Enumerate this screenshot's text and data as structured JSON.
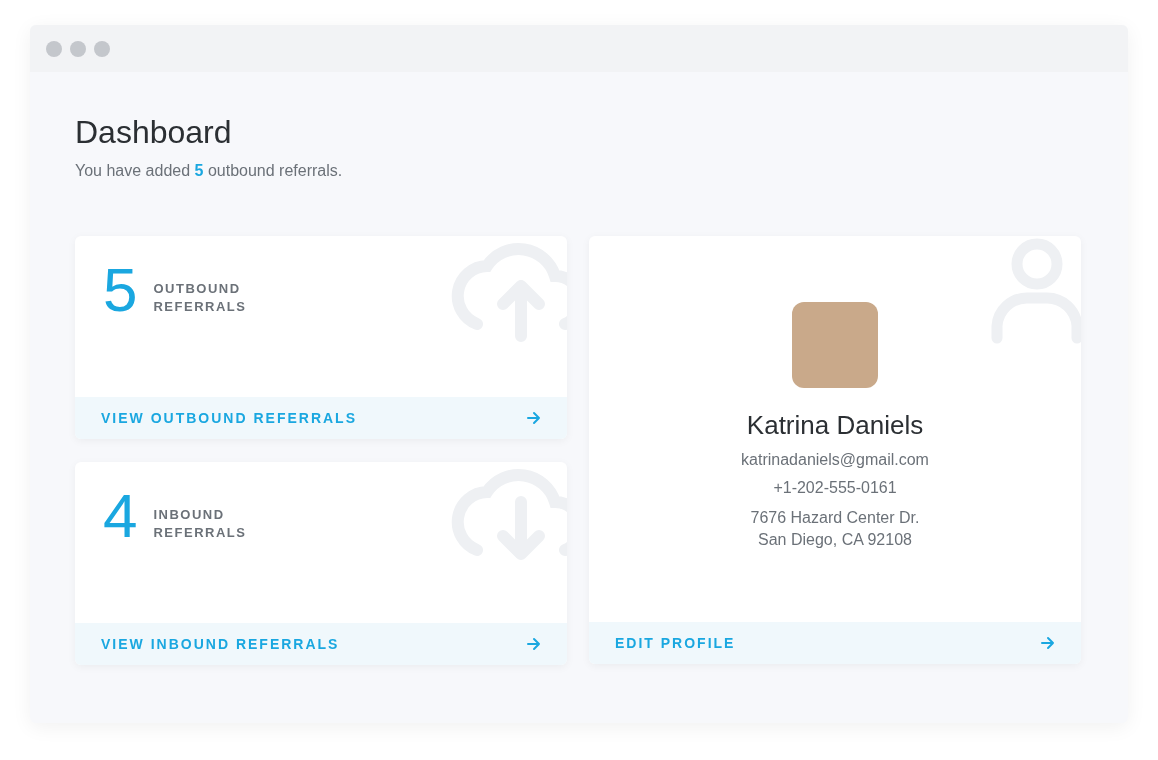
{
  "header": {
    "title": "Dashboard",
    "subtitle": "You have added **5** outbound referrals."
  },
  "stats": [
    {
      "kind": "upload",
      "count": "5",
      "label": "OUTBOUND REFERRALS",
      "link": "VIEW OUTBOUND REFERRALS"
    },
    {
      "kind": "download",
      "count": "4",
      "label": "INBOUND REFERRALS",
      "link": "VIEW INBOUND REFERRALS"
    }
  ],
  "profile": {
    "name": "Katrina Daniels",
    "email": "katrinadaniels@gmail.com",
    "phone": "+1-202-555-0161",
    "address": [
      "7676 Hazard Center Dr.",
      "San Diego, CA 92108"
    ],
    "link": "EDIT PROFILE"
  }
}
